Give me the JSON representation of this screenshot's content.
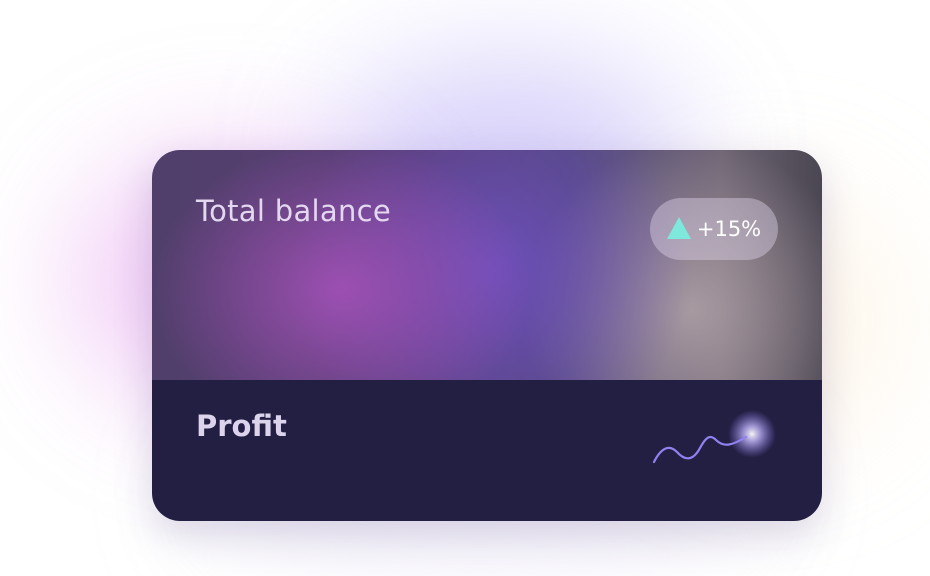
{
  "card": {
    "balance_label": "Total balance",
    "change_badge": "+15%",
    "profit_label": "Profit"
  },
  "icons": {
    "trend": "up-triangle-icon",
    "sparkline": "profit-sparkline"
  },
  "colors": {
    "accent_teal": "#7ee8dc",
    "sparkline": "#8f82f0",
    "card_bottom": "#231f43"
  }
}
